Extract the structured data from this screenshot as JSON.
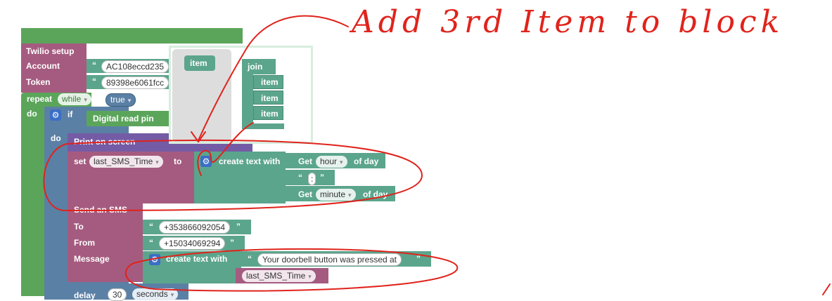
{
  "annotation": {
    "title": "Add 3rd Item to block"
  },
  "twilio": {
    "title": "Twilio setup",
    "account_label": "Account",
    "account_value": "AC108eccd235",
    "token_label": "Token",
    "token_value": "89398e6061fcc"
  },
  "repeat": {
    "label": "repeat",
    "mode": "while",
    "condition": "true",
    "do_label": "do"
  },
  "if_block": {
    "label": "if",
    "condition": "Digital read pin",
    "do_label": "do"
  },
  "print": {
    "label": "Print on screen"
  },
  "set": {
    "label": "set",
    "variable": "last_SMS_Time",
    "to_label": "to",
    "create_label": "create text with",
    "get_label": "Get",
    "hour": "hour",
    "of_day": "of day",
    "colon": ":",
    "minute": "minute"
  },
  "flyout": {
    "item_label": "item",
    "join_label": "join",
    "items": [
      "item",
      "item",
      "item"
    ]
  },
  "sms": {
    "title": "Send an SMS",
    "to_label": "To",
    "to_value": "+353866092054",
    "from_label": "From",
    "from_value": "+15034069294",
    "message_label": "Message",
    "create_label": "create text with",
    "message_text": "Your doorbell button was pressed at",
    "variable": "last_SMS_Time"
  },
  "delay": {
    "label": "delay",
    "value": "30",
    "unit": "seconds"
  },
  "quote_open": "“",
  "quote_close": "”",
  "colors": {
    "text_block": "#5ba58c",
    "variable": "#a55b80",
    "control": "#5ba55b",
    "twilio": "#a55b7f",
    "print": "#745ba5",
    "logic_blue": "#5b80a5",
    "ink": "#e0231c"
  }
}
